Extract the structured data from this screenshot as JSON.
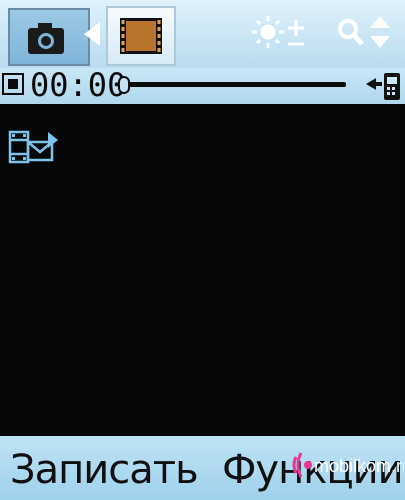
{
  "toolbar": {
    "tabs": [
      {
        "id": "camera",
        "icon": "camera-icon",
        "selected": false
      },
      {
        "id": "video",
        "icon": "film-strip-icon",
        "selected": true
      }
    ],
    "right_icons": [
      "brightness-icon",
      "zoom-icon"
    ]
  },
  "recording": {
    "timer": "00:00",
    "progress": 0.0,
    "storage_icon": "phone-memory-icon"
  },
  "viewfinder": {
    "mode_icon": "video-message-mode-icon"
  },
  "softkeys": {
    "left": "Записать",
    "right": "Функции"
  },
  "watermark": {
    "text": "mobilkom.ru"
  },
  "colors": {
    "bar_blue": "#b9dcef",
    "icon_blue": "#9fd1ec",
    "screen_black": "#060708"
  }
}
